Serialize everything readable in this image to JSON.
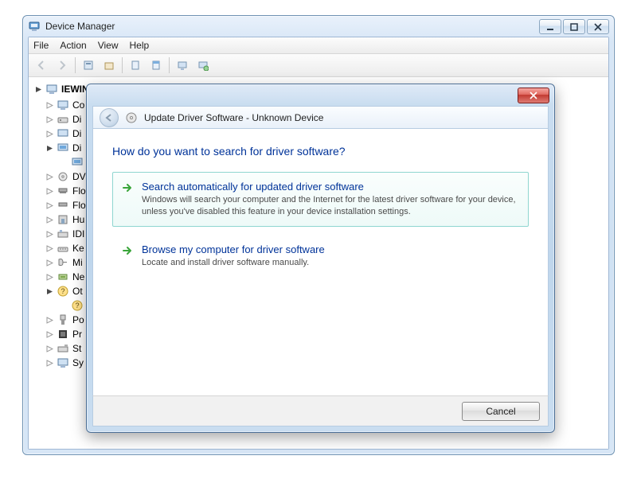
{
  "dm": {
    "title": "Device Manager",
    "menu": [
      "File",
      "Action",
      "View",
      "Help"
    ],
    "root": "IEWIN",
    "items": [
      "Co",
      "Di",
      "Di",
      "Di",
      "DV",
      "Flo",
      "Flo",
      "Hu",
      "IDI",
      "Ke",
      "Mi",
      "Ne",
      "Ot",
      "Po",
      "Pr",
      "St",
      "Sy"
    ]
  },
  "dlg": {
    "title": "Update Driver Software - Unknown Device",
    "heading": "How do you want to search for driver software?",
    "opt1": {
      "title": "Search automatically for updated driver software",
      "desc": "Windows will search your computer and the Internet for the latest driver software for your device, unless you've disabled this feature in your device installation settings."
    },
    "opt2": {
      "title": "Browse my computer for driver software",
      "desc": "Locate and install driver software manually."
    },
    "cancel": "Cancel"
  }
}
